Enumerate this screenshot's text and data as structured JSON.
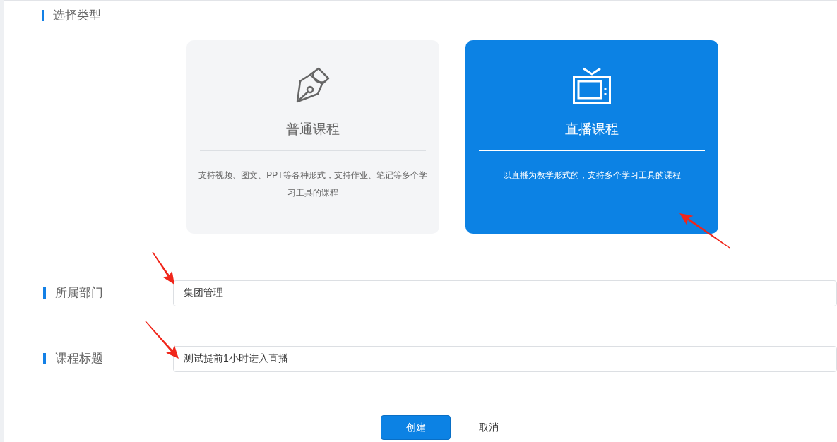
{
  "section_title": "选择类型",
  "course_types": [
    {
      "kind": "normal",
      "title": "普通课程",
      "description": "支持视频、图文、PPT等各种形式，支持作业、笔记等多个学习工具的课程",
      "selected": false
    },
    {
      "kind": "live",
      "title": "直播课程",
      "description": "以直播为教学形式的，支持多个学习工具的课程",
      "selected": true
    }
  ],
  "fields": [
    {
      "label": "所属部门",
      "value": "集团管理"
    },
    {
      "label": "课程标题",
      "value": "测试提前1小时进入直播"
    }
  ],
  "buttons": [
    {
      "kind": "primary",
      "label": "创建"
    },
    {
      "kind": "plain",
      "label": "取消"
    }
  ]
}
